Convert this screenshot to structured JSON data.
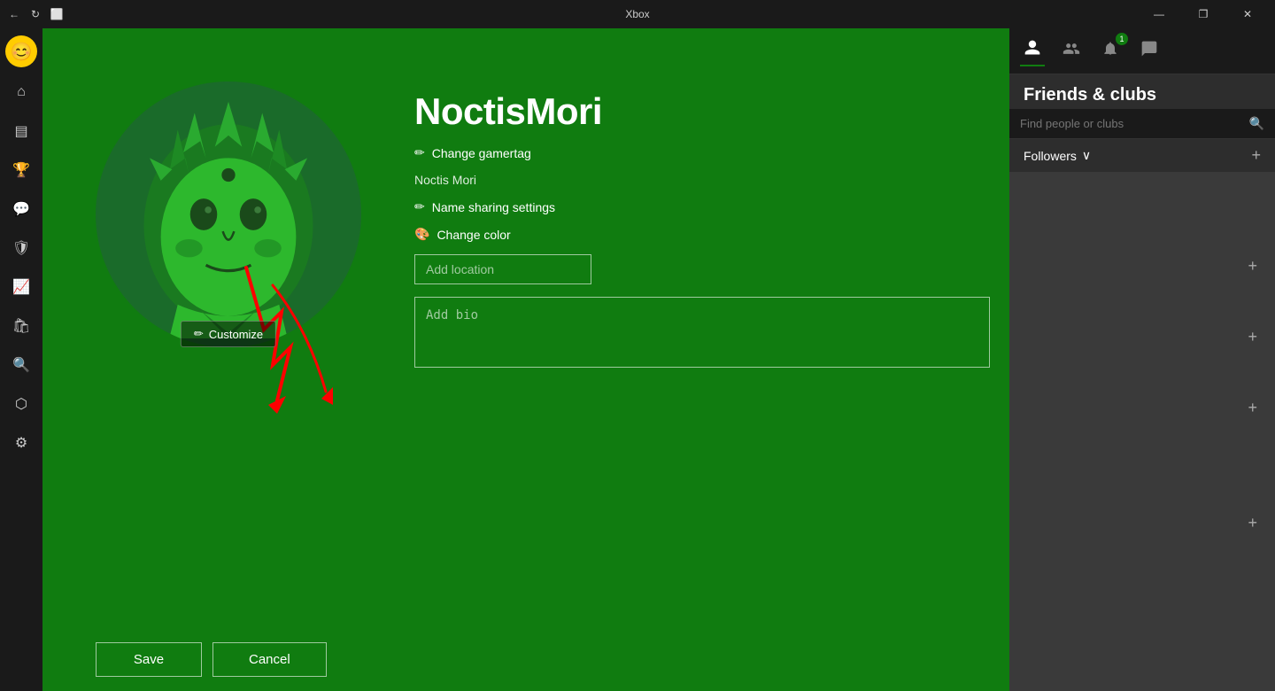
{
  "titlebar": {
    "title": "Xbox",
    "back_label": "←",
    "refresh_label": "↻",
    "capture_label": "⬜",
    "minimize_label": "—",
    "restore_label": "❐",
    "close_label": "✕"
  },
  "sidebar": {
    "avatar_emoji": "😊",
    "items": [
      {
        "name": "home",
        "icon": "⌂"
      },
      {
        "name": "library",
        "icon": "▤"
      },
      {
        "name": "achievements",
        "icon": "🏆"
      },
      {
        "name": "messages",
        "icon": "💬"
      },
      {
        "name": "shield",
        "icon": "🛡"
      },
      {
        "name": "trending",
        "icon": "📈"
      },
      {
        "name": "store",
        "icon": "🛍"
      },
      {
        "name": "search",
        "icon": "🔍"
      },
      {
        "name": "share",
        "icon": "⬡"
      },
      {
        "name": "settings",
        "icon": "⚙"
      }
    ]
  },
  "profile": {
    "gamertag": "NoctisMori",
    "real_name": "Noctis Mori",
    "change_gamertag_label": "Change gamertag",
    "name_sharing_label": "Name sharing settings",
    "change_color_label": "Change color",
    "add_location_placeholder": "Add location",
    "add_bio_placeholder": "Add bio",
    "customize_label": "Customize"
  },
  "buttons": {
    "save_label": "Save",
    "cancel_label": "Cancel"
  },
  "right_panel": {
    "title": "Friends & clubs",
    "search_placeholder": "Find people or clubs",
    "followers_label": "Followers",
    "tabs": [
      {
        "name": "people",
        "icon": "👤"
      },
      {
        "name": "group",
        "icon": "👥"
      },
      {
        "name": "notification",
        "icon": "🔔",
        "badge": "1"
      },
      {
        "name": "chat",
        "icon": "💬"
      }
    ],
    "add_buttons": [
      "+",
      "+",
      "+",
      "+"
    ]
  }
}
